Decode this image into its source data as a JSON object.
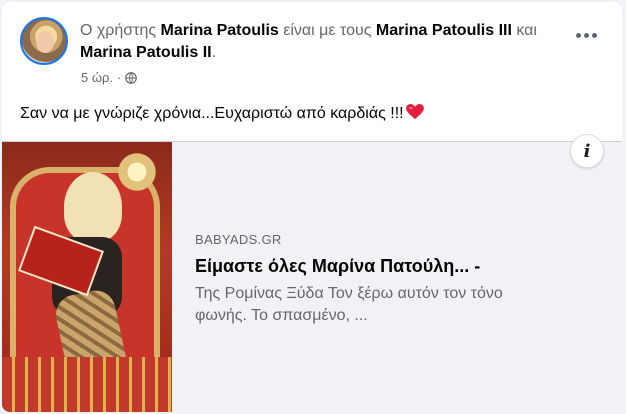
{
  "post": {
    "header": {
      "prefix": "Ο χρήστης ",
      "author": "Marina Patoulis",
      "with_text": " είναι με τους ",
      "tagged_1": "Marina Patoulis III",
      "and_text": " και ",
      "tagged_2": "Marina Patoulis II",
      "suffix": "."
    },
    "time": "5 ώρ.",
    "separator": "·",
    "privacy_icon": "globe-icon",
    "more_icon": "more-options-icon",
    "text": "Σαν να με γνώριζε χρόνια...Ευχαριστώ από καρδιάς !!!",
    "emoji": "heart-icon"
  },
  "link_card": {
    "domain": "BABYADS.GR",
    "title": "Είμαστε όλες Μαρίνα Πατούλη... -",
    "description_line1": "Της Ρομίνας Ξύδα Τον ξέρω αυτόν τον τόνο",
    "description_line2": "φωνής. Το σπασμένο, ...",
    "info_icon": "i"
  },
  "colors": {
    "accent": "#1877f2",
    "secondary_text": "#65676b",
    "heart": "#e41e3f"
  }
}
